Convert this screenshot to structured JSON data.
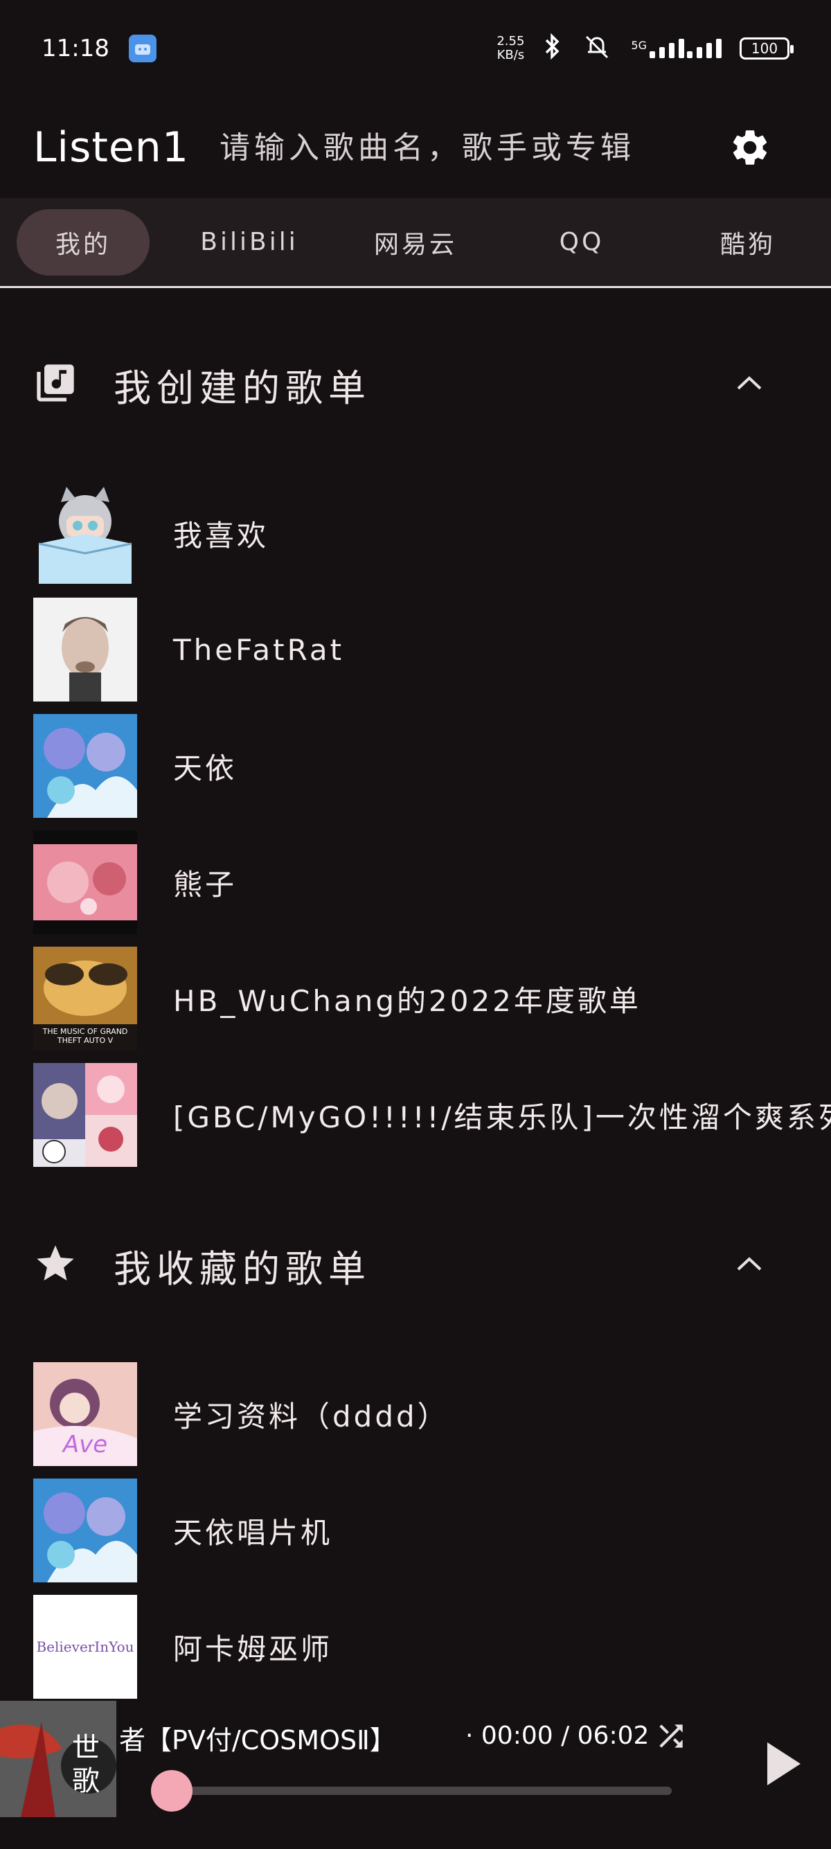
{
  "status_bar": {
    "time": "11:18",
    "net_speed_value": "2.55",
    "net_speed_unit": "KB/s",
    "network": "5G",
    "battery": "100"
  },
  "header": {
    "brand": "Listen1",
    "search_placeholder": "请输入歌曲名，歌手或专辑"
  },
  "tabs": [
    {
      "label": "我的",
      "active": true
    },
    {
      "label": "BiliBili",
      "active": false
    },
    {
      "label": "网易云",
      "active": false
    },
    {
      "label": "QQ",
      "active": false
    },
    {
      "label": "酷狗",
      "active": false
    }
  ],
  "created_section": {
    "title": "我创建的歌单",
    "items": [
      {
        "name": "我喜欢"
      },
      {
        "name": "TheFatRat"
      },
      {
        "name": "天依"
      },
      {
        "name": "熊子"
      },
      {
        "name": "HB_WuChang的2022年度歌单",
        "cover_caption": "THE MUSIC OF GRAND THEFT AUTO V"
      },
      {
        "name": "[GBC/MyGO!!!!!/结束乐队]一次性溜个爽系列"
      }
    ]
  },
  "favorite_section": {
    "title": "我收藏的歌单",
    "items": [
      {
        "name": "学习资料（dddd）"
      },
      {
        "name": "天依唱片机"
      },
      {
        "name": "阿卡姆巫师",
        "cover_caption": "BelieverInYou"
      }
    ]
  },
  "player": {
    "title": "者【PV付/COSMOSⅡ】",
    "time": "· 00:00 / 06:02",
    "progress": 0.0,
    "cover_caption": "世歌"
  },
  "colors": {
    "background": "#151112",
    "tab_bar": "#221c1e",
    "active_tab": "#4a3a3d",
    "progress_knob": "#f4a8b6"
  }
}
